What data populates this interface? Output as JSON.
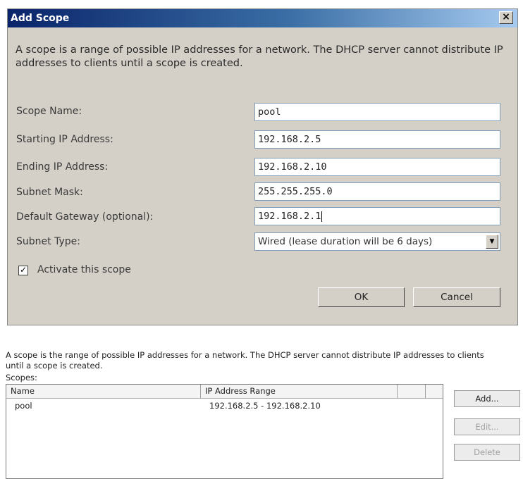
{
  "dialog": {
    "title": "Add Scope",
    "close_glyph": "×",
    "description": "A scope is a range of possible IP addresses for a network. The DHCP server cannot distribute IP addresses to clients until a scope is created.",
    "fields": [
      {
        "label": "Scope Name:",
        "value": "pool"
      },
      {
        "label": "Starting IP Address:",
        "value": "192.168.2.5"
      },
      {
        "label": "Ending IP Address:",
        "value": "192.168.2.10"
      },
      {
        "label": "Subnet Mask:",
        "value": "255.255.255.0"
      },
      {
        "label": "Default Gateway (optional):",
        "value": "192.168.2.1"
      }
    ],
    "subnet_type": {
      "label": "Subnet Type:",
      "value": "Wired (lease duration will be 6 days)",
      "arrow_glyph": "▼"
    },
    "activate": {
      "label": "Activate this scope",
      "checked": true,
      "check_glyph": "✓"
    },
    "ok_label": "OK",
    "cancel_label": "Cancel"
  },
  "scopes_panel": {
    "description": "A scope is the range of possible IP addresses for a network. The DHCP server cannot distribute IP addresses to clients until a scope is created.",
    "scopes_label": "Scopes:",
    "columns": [
      "Name",
      "IP Address Range",
      ""
    ],
    "rows": [
      {
        "name": "pool",
        "range": "192.168.2.5 - 192.168.2.10"
      }
    ],
    "buttons": {
      "add": "Add...",
      "edit": "Edit...",
      "delete": "Delete"
    }
  },
  "colors": {
    "titlebar_start": "#0a246a",
    "titlebar_end": "#a6caf0",
    "dialog_bg": "#d4d0c8",
    "disabled_text": "#a0a0a0"
  }
}
